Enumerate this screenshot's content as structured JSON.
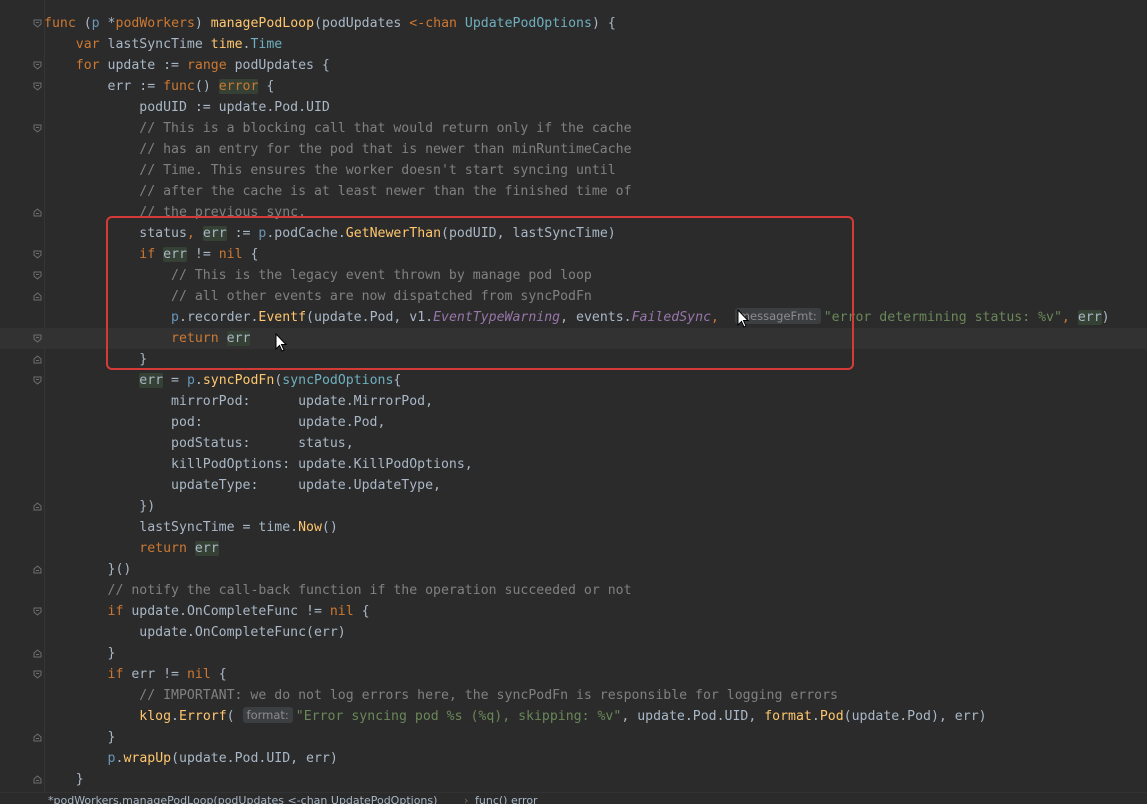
{
  "code": {
    "line1": {
      "kw1": "func",
      "recv_open": " (",
      "recv": "p",
      "ptr": " *",
      "recv_type": "podWorkers",
      "rp": ") ",
      "fname": "managePodLoop",
      "params_open": "(podUpdates ",
      "chan_arrow": "<-",
      "chan_kw": "chan",
      "sp": " ",
      "ptype": "UpdatePodOptions",
      "end": ") {"
    },
    "line2": {
      "kw": "var",
      "rest": " lastSyncTime ",
      "pkg": "time",
      "dot": ".",
      "type": "Time"
    },
    "line3": {
      "kw": "for",
      "mid": " update := ",
      "range": "range",
      "rest": " podUpdates {"
    },
    "line4": {
      "pre": "err := ",
      "func": "func",
      "paren": "() ",
      "err_type": "error",
      "brace": " {"
    },
    "line5": {
      "text": "podUID := update.Pod.UID"
    },
    "line6": {
      "text": "// This is a blocking call that would return only if the cache"
    },
    "line7": {
      "text": "// has an entry for the pod that is newer than minRuntimeCache"
    },
    "line8": {
      "text": "// Time. This ensures the worker doesn't start syncing until"
    },
    "line9": {
      "text": "// after the cache is at least newer than the finished time of"
    },
    "line10": {
      "text": "// the previous sync."
    },
    "line11": {
      "status": "status",
      "comma": ", ",
      "err": "err",
      "assign": " := ",
      "p": "p",
      "field": ".podCache.",
      "method": "GetNewerThan",
      "args": "(podUID, lastSyncTime)"
    },
    "line12": {
      "kw": "if",
      "sp": " ",
      "err": "err",
      "cmp": " != ",
      "nil": "nil",
      "brace": " {"
    },
    "line13": {
      "text": "// This is the legacy event thrown by manage pod loop"
    },
    "line14": {
      "text": "// all other events are now dispatched from syncPodFn"
    },
    "line15": {
      "p": "p",
      "field": ".recorder.",
      "method": "Eventf",
      "a1": "(update.Pod, v1.",
      "c1": "EventTypeWarning",
      "a2": ", events.",
      "c2": "FailedSync",
      "a3": ",  ",
      "hint": "messageFmt:",
      "str": "\"error determining status: %v\"",
      "a4": ", ",
      "err": "err",
      "close": ")"
    },
    "line16": {
      "kw": "return",
      "sp": " ",
      "err": "err"
    },
    "line17": {
      "text": "}"
    },
    "line18": {
      "err": "err",
      "eq": " = ",
      "p": "p",
      "dot": ".",
      "method": "syncPodFn",
      "open": "(",
      "type": "syncPodOptions",
      "brace": "{"
    },
    "line19": {
      "text": "mirrorPod:      update.MirrorPod,"
    },
    "line20": {
      "text": "pod:            update.Pod,"
    },
    "line21": {
      "text": "podStatus:      status,"
    },
    "line22": {
      "text": "killPodOptions: update.KillPodOptions,"
    },
    "line23": {
      "text": "updateType:     update.UpdateType,"
    },
    "line24": {
      "text": "})"
    },
    "line25": {
      "pre": "lastSyncTime = time.",
      "method": "Now",
      "post": "()"
    },
    "line26": {
      "kw": "return",
      "sp": " ",
      "err": "err"
    },
    "line27": {
      "text": "}()"
    },
    "line28": {
      "text": "// notify the call-back function if the operation succeeded or not"
    },
    "line29": {
      "kw": "if",
      "mid": " update.OnCompleteFunc != ",
      "nil": "nil",
      "brace": " {"
    },
    "line30": {
      "text": "update.OnCompleteFunc(err)"
    },
    "line31": {
      "text": "}"
    },
    "line32": {
      "kw": "if",
      "mid": " err != ",
      "nil": "nil",
      "brace": " {"
    },
    "line33": {
      "text": "// IMPORTANT: we do not log errors here, the syncPodFn is responsible for logging errors"
    },
    "line34": {
      "pkg": "klog",
      "dot": ".",
      "method": "Errorf",
      "open": "( ",
      "hint": "format:",
      "str": "\"Error syncing pod %s (%q), skipping: %v\"",
      "mid": ", update.Pod.UID, ",
      "fmt": "format",
      "dot2": ".",
      "m2": "Pod",
      "end": "(update.Pod), err)"
    },
    "line35": {
      "text": "}"
    },
    "line36": {
      "p": "p",
      "dot": ".",
      "method": "wrapUp",
      "args": "(update.Pod.UID, err)"
    },
    "line37": {
      "text": "}"
    }
  },
  "breadcrumb": {
    "item1": "*podWorkers.managePodLoop(podUpdates <-chan UpdatePodOptions)",
    "separator": "›",
    "item2": "func() error"
  },
  "colors": {
    "highlight_box": "#d43b37",
    "background": "#2b2b2b"
  }
}
